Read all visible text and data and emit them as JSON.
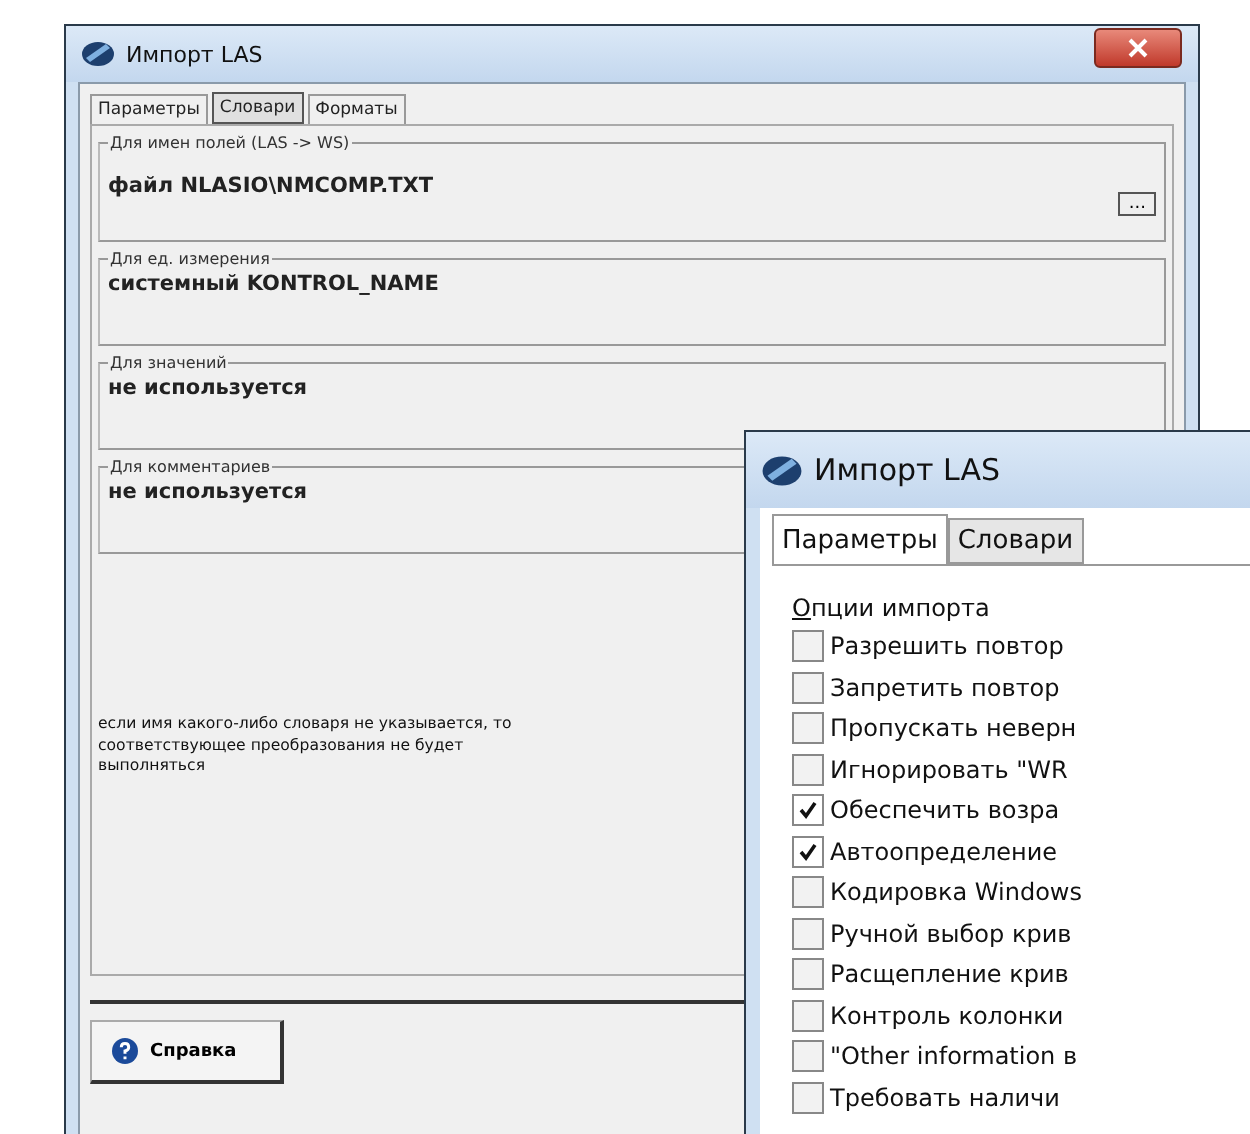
{
  "dictionaries_window": {
    "title": "Импорт LAS",
    "tabs": [
      {
        "label": "Параметры",
        "selected": false
      },
      {
        "label": "Словари",
        "selected": true
      },
      {
        "label": "Форматы",
        "selected": false
      }
    ],
    "groups": [
      {
        "legend": "Для имен полей (LAS -> WS)",
        "value": "файл NLASIO\\NMCOMP.TXT",
        "browse_button": "..."
      },
      {
        "legend": "Для ед. измерения",
        "value": "системный KONTROL_NAME"
      },
      {
        "legend": "Для значений",
        "value": "не используется"
      },
      {
        "legend": "Для комментариев",
        "value": "не используется"
      }
    ],
    "note": "если имя какого-либо словаря не указывается, то соответствующее преобразования не будет выполняться",
    "help_button": "Справка"
  },
  "options_window": {
    "title": "Импорт LAS",
    "tabs": [
      {
        "label": "Параметры",
        "selected": true
      },
      {
        "label": "Словари",
        "selected": false
      }
    ],
    "options_title": "Опции импорта",
    "options": [
      {
        "label": "Разрешить повтор",
        "checked": false
      },
      {
        "label": "Запретить повтор",
        "checked": false
      },
      {
        "label": "Пропускать неверн",
        "checked": false
      },
      {
        "label": "Игнорировать \"WR",
        "checked": false
      },
      {
        "label": "Обеспечить возра",
        "checked": true
      },
      {
        "label": "Автоопределение",
        "checked": true
      },
      {
        "label": "Кодировка Windows",
        "checked": false
      },
      {
        "label": "Ручной выбор крив",
        "checked": false
      },
      {
        "label": "Расщепление крив",
        "checked": false
      },
      {
        "label": "Контроль колонки",
        "checked": false
      },
      {
        "label": "\"Other information в",
        "checked": false
      },
      {
        "label": "Требовать наличи",
        "checked": false
      }
    ]
  }
}
